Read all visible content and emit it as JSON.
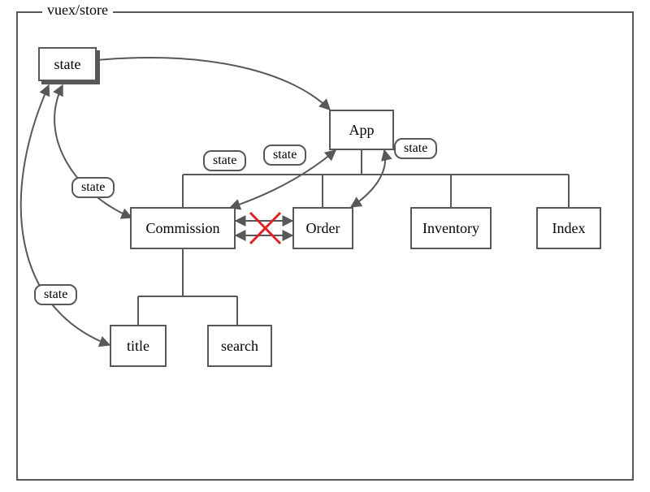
{
  "frame": {
    "title": "vuex/store"
  },
  "nodes": {
    "state_root": "state",
    "app": "App",
    "commission": "Commission",
    "order": "Order",
    "inventory": "Inventory",
    "index": "Index",
    "title": "title",
    "search": "search"
  },
  "edge_labels": {
    "e1": "state",
    "e2": "state",
    "e3": "state",
    "e4": "state",
    "e5": "state"
  }
}
